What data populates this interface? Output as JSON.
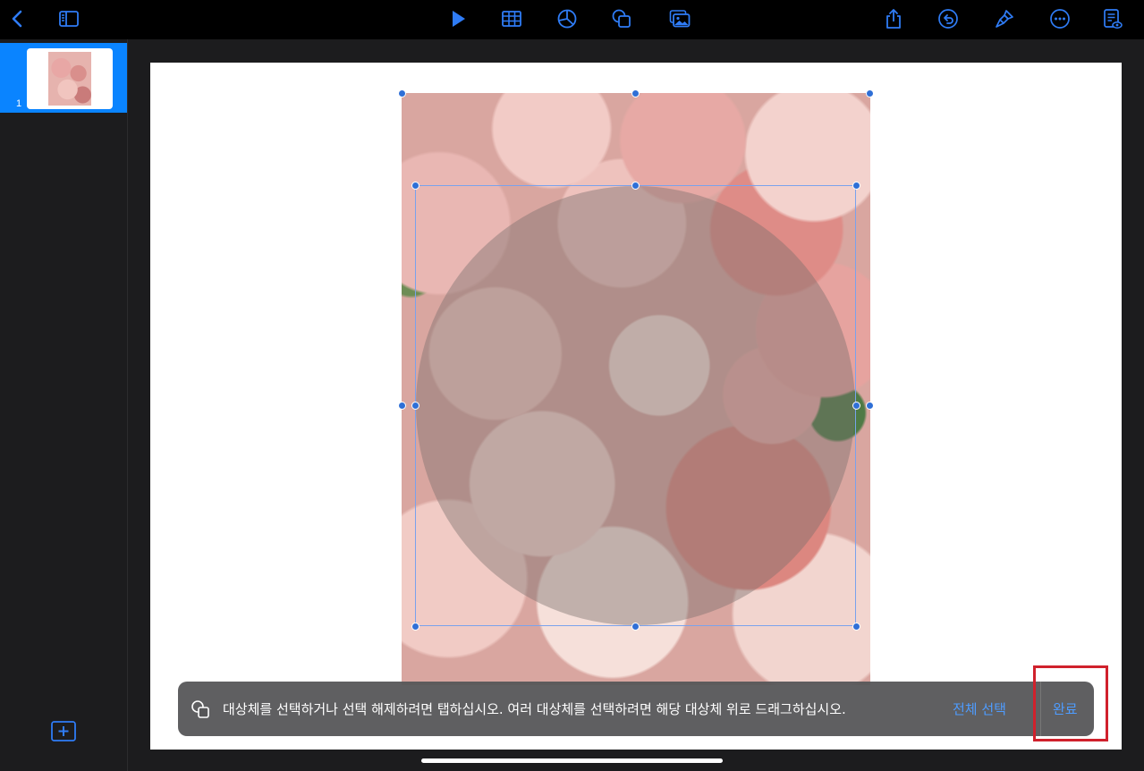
{
  "toolbar": {
    "icons": [
      "back-icon",
      "sidebar-icon",
      "play-icon",
      "table-icon",
      "chart-icon",
      "shapes-icon",
      "media-icon",
      "share-icon",
      "undo-icon",
      "format-brush-icon",
      "more-icon",
      "document-view-icon"
    ],
    "accent_color": "#2f7cf6"
  },
  "sidebar": {
    "slides": [
      {
        "number": "1"
      }
    ],
    "selected_color": "#0a84ff"
  },
  "message_bar": {
    "text": "대상체를 선택하거나 선택 해제하려면 탭하십시오. 여러 대상체를 선택하려면 해당 대상체 위로 드래그하십시오.",
    "select_all_label": "전체 선택",
    "done_label": "완료"
  },
  "colors": {
    "highlight": "#d0212c",
    "selection_handle": "#2f6fd6"
  }
}
